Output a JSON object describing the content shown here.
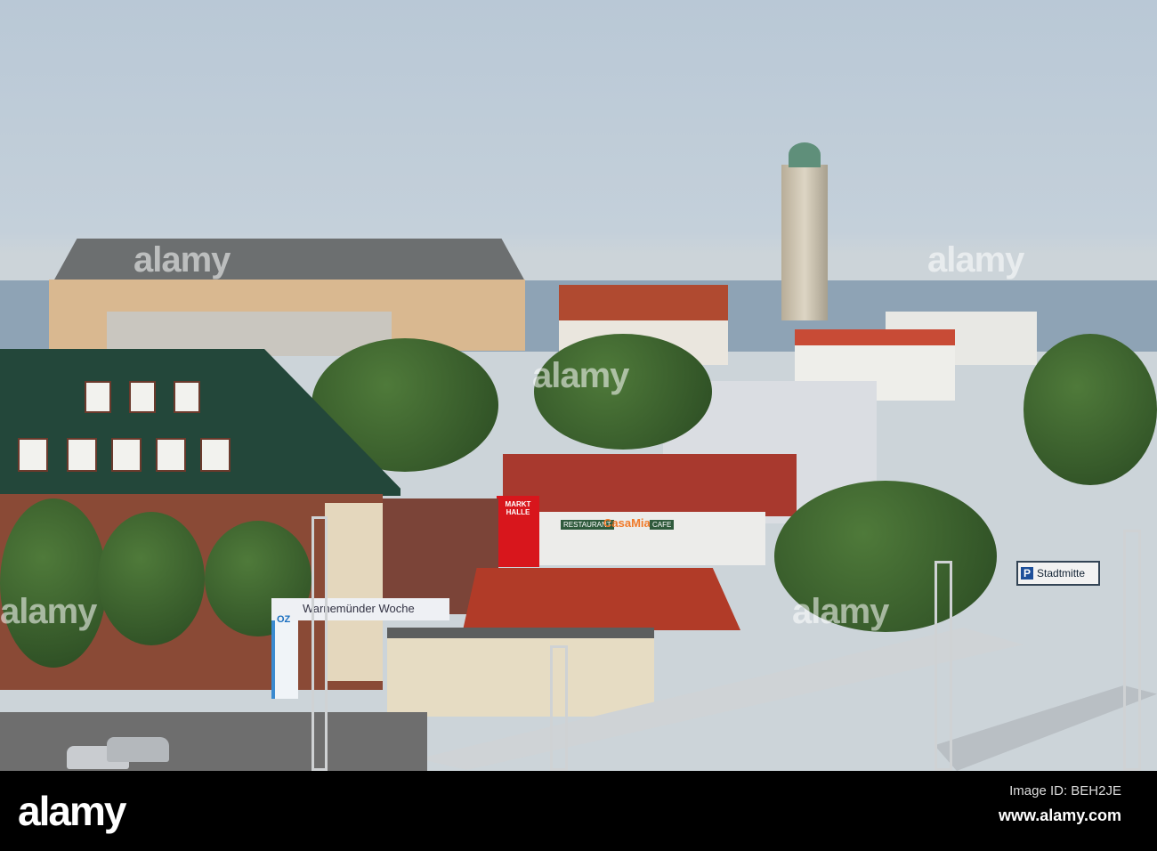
{
  "watermark": {
    "logo": "alamy"
  },
  "signs": {
    "stadtmitte": "Stadtmitte",
    "parking_p": "P",
    "banner": "Warnemünder Woche",
    "oz": "OZ",
    "markthalle": "MARKT HALLE",
    "restaurant": "RESTAURANT",
    "casamia": "CasaMia",
    "cafe": "CAFE"
  },
  "footer": {
    "logo": "alamy",
    "image_id": "Image ID: BEH2JE",
    "url": "www.alamy.com"
  }
}
